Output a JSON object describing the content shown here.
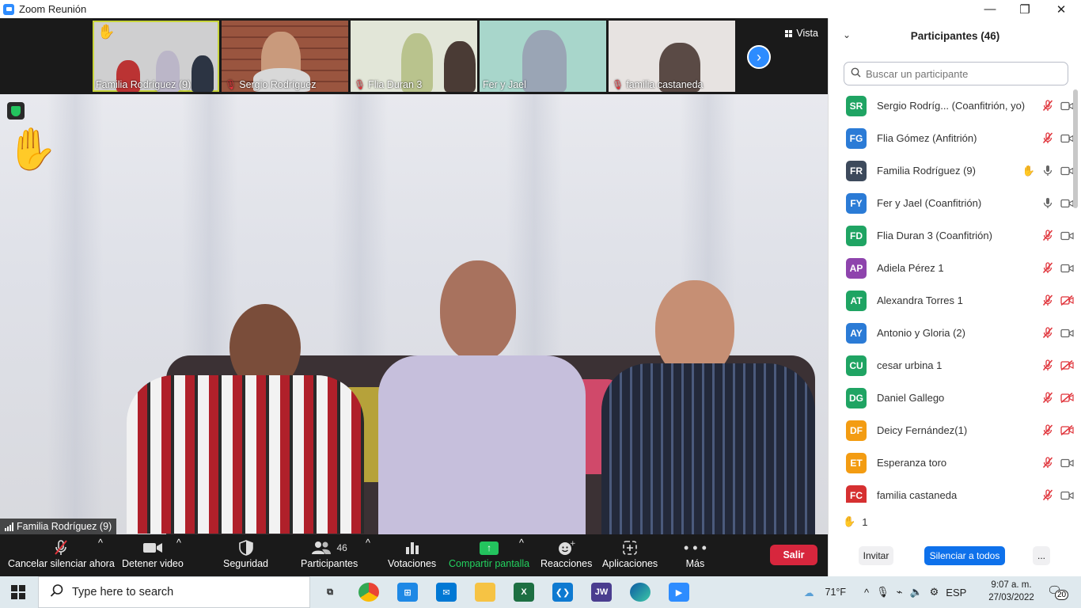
{
  "window": {
    "title": "Zoom Reunión",
    "controls": [
      "—",
      "❐",
      "✕"
    ]
  },
  "strip": {
    "thumbnails": [
      {
        "name": "Familia Rodríguez (9)",
        "muted": false,
        "hand": true,
        "active": true
      },
      {
        "name": "Sergio Rodríguez",
        "muted": true,
        "hand": false,
        "active": false
      },
      {
        "name": "Flia Duran 3",
        "muted": true,
        "hand": false,
        "active": false
      },
      {
        "name": "Fer y Jael",
        "muted": false,
        "hand": false,
        "active": false
      },
      {
        "name": "familia castaneda",
        "muted": true,
        "hand": false,
        "active": false
      }
    ],
    "view_label": "Vista"
  },
  "main_video": {
    "speaker_label": "Familia Rodríguez (9)"
  },
  "toolbar": {
    "mute_label": "Cancelar silenciar ahora",
    "video_label": "Detener video",
    "security_label": "Seguridad",
    "participants_label": "Participantes",
    "participants_count": "46",
    "polls_label": "Votaciones",
    "share_label": "Compartir pantalla",
    "reactions_label": "Reacciones",
    "apps_label": "Aplicaciones",
    "more_label": "Más",
    "leave_label": "Salir"
  },
  "panel": {
    "title": "Participantes (46)",
    "search_placeholder": "Buscar un participante",
    "participants": [
      {
        "initials": "SR",
        "color": "#1fa463",
        "name": "Sergio Rodríg...  (Coanfitrión, yo)",
        "mic": "muted",
        "cam": "on",
        "hand": false
      },
      {
        "initials": "FG",
        "color": "#2b7bd6",
        "name": "Flia Gómez (Anfitrión)",
        "mic": "muted",
        "cam": "on",
        "hand": false
      },
      {
        "initials": "FR",
        "color": "#3d4a5c",
        "name": "Familia Rodríguez (9)",
        "mic": "on",
        "cam": "on",
        "hand": true
      },
      {
        "initials": "FY",
        "color": "#2b7bd6",
        "name": "Fer y Jael (Coanfitrión)",
        "mic": "on",
        "cam": "on",
        "hand": false
      },
      {
        "initials": "FD",
        "color": "#1fa463",
        "name": "Flia Duran 3 (Coanfitrión)",
        "mic": "muted",
        "cam": "on",
        "hand": false
      },
      {
        "initials": "AP",
        "color": "#8e44ad",
        "name": "Adiela Pérez 1",
        "mic": "muted",
        "cam": "on",
        "hand": false
      },
      {
        "initials": "AT",
        "color": "#1fa463",
        "name": "Alexandra Torres 1",
        "mic": "muted",
        "cam": "off",
        "hand": false
      },
      {
        "initials": "AY",
        "color": "#2b7bd6",
        "name": "Antonio y Gloria (2)",
        "mic": "muted",
        "cam": "on",
        "hand": false
      },
      {
        "initials": "CU",
        "color": "#1fa463",
        "name": "cesar urbina 1",
        "mic": "muted",
        "cam": "off",
        "hand": false
      },
      {
        "initials": "DG",
        "color": "#1fa463",
        "name": "Daniel Gallego",
        "mic": "muted",
        "cam": "off",
        "hand": false
      },
      {
        "initials": "DF",
        "color": "#f39c12",
        "name": "Deicy Fernández(1)",
        "mic": "muted",
        "cam": "off",
        "hand": false
      },
      {
        "initials": "ET",
        "color": "#f39c12",
        "name": "Esperanza toro",
        "mic": "muted",
        "cam": "on",
        "hand": false
      },
      {
        "initials": "FC",
        "color": "#d63031",
        "name": "familia castaneda",
        "mic": "muted",
        "cam": "on",
        "hand": false
      }
    ],
    "raised_hands_count": "1",
    "invite_label": "Invitar",
    "mute_all_label": "Silenciar a todos",
    "more_label": "..."
  },
  "taskbar": {
    "search_placeholder": "Type here to search",
    "weather": "71°F",
    "language": "ESP",
    "time": "9:07 a. m.",
    "date": "27/03/2022",
    "notification_count": "20"
  }
}
